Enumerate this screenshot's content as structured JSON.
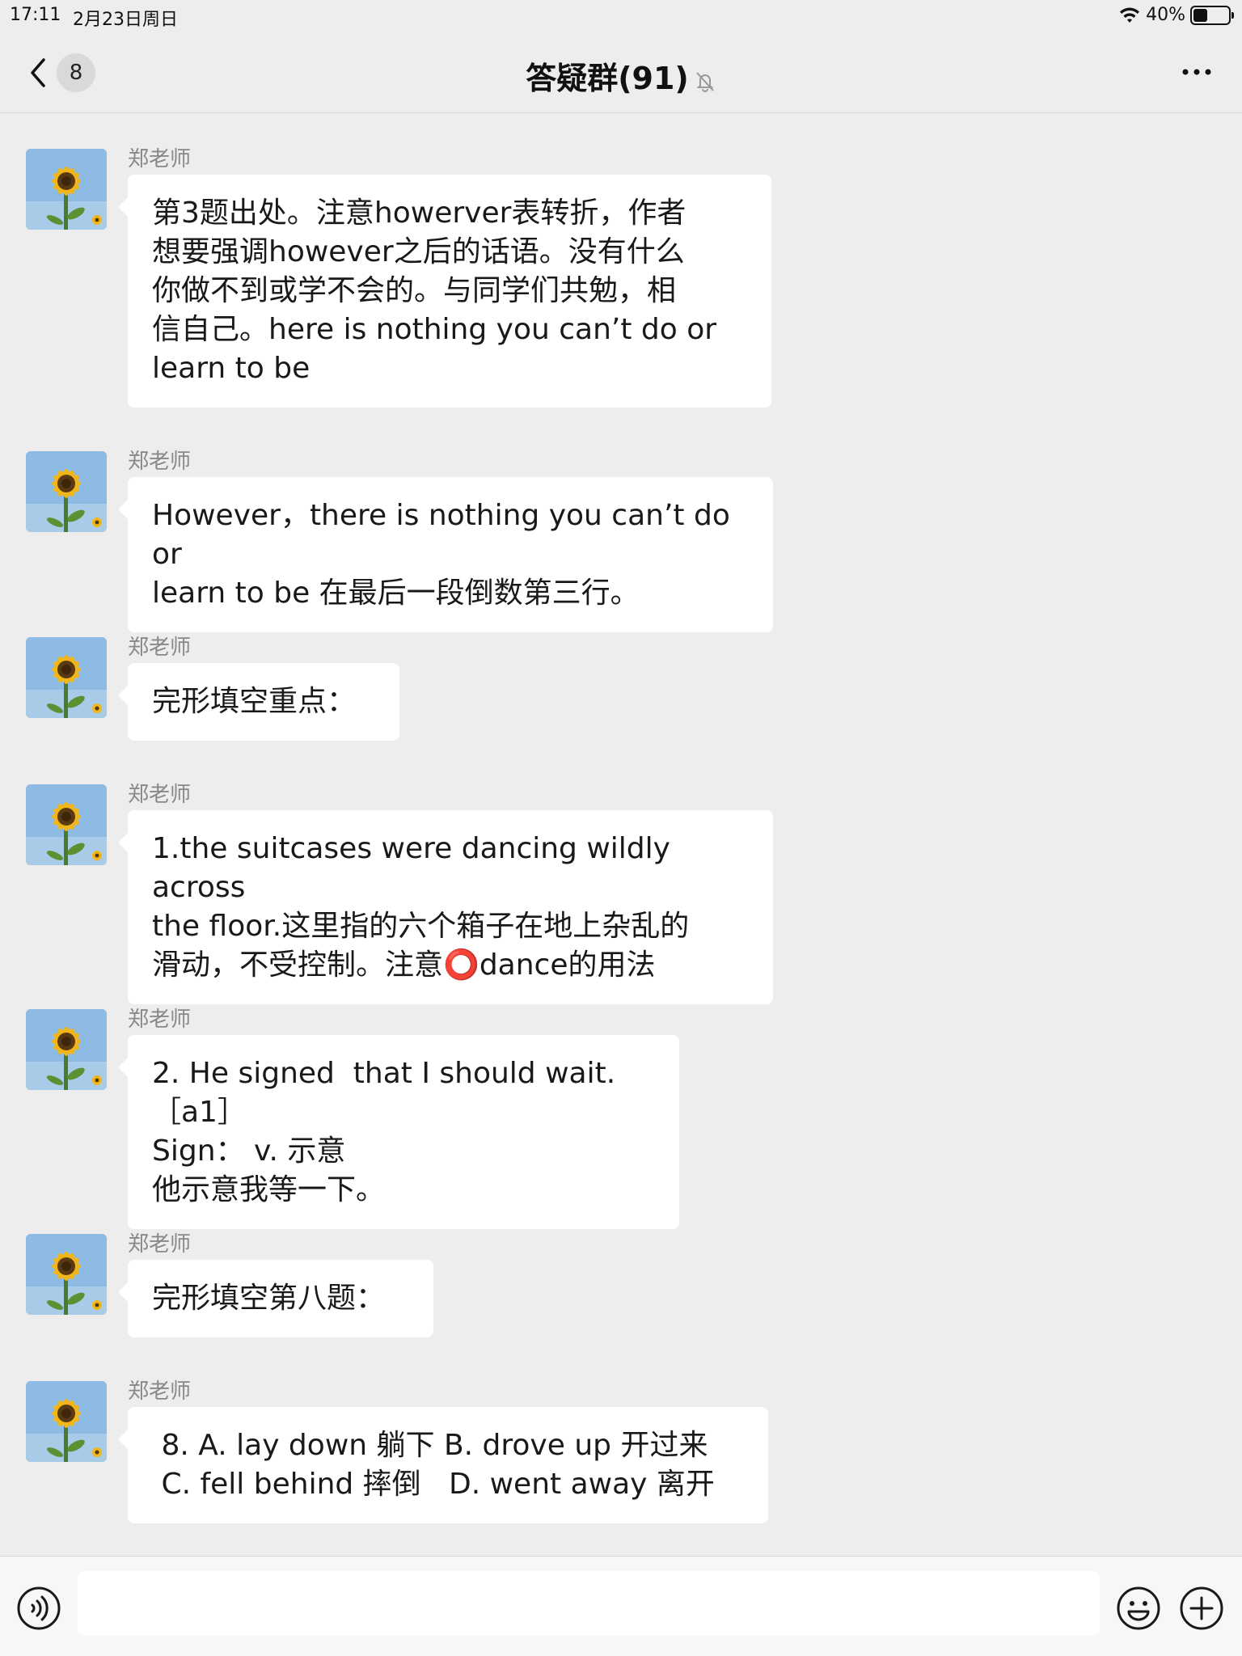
{
  "status": {
    "time": "17:11",
    "date": "2月23日周日",
    "battery": "40%",
    "battery_level": 0.4
  },
  "nav": {
    "back_count": "8",
    "title": "答疑群(91)"
  },
  "messages": [
    {
      "sender": "郑老师",
      "text": "第3题出处。注意howerver表转折，作者\n想要强调however之后的话语。没有什么\n你做不到或学不会的。与同学们共勉，相\n信自己。here is nothing you can’t do or\nlearn to be"
    },
    {
      "sender": "郑老师",
      "text": "However，there is nothing you can’t do or\nlearn to be 在最后一段倒数第三行。"
    },
    {
      "sender": "郑老师",
      "text": "完形填空重点："
    },
    {
      "sender": "郑老师",
      "text": "1.the suitcases were dancing wildly across\nthe floor.这里指的六个箱子在地上杂乱的\n滑动，不受控制。注意⭕dance的用法"
    },
    {
      "sender": "郑老师",
      "text": "2. He signed  that I should wait.［a1］\nSign： v. 示意\n他示意我等一下。"
    },
    {
      "sender": "郑老师",
      "text": "完形填空第八题："
    },
    {
      "sender": "郑老师",
      "text": " 8. A. lay down 躺下 B. drove up 开过来\n C. fell behind 摔倒   D. went away 离开"
    }
  ]
}
